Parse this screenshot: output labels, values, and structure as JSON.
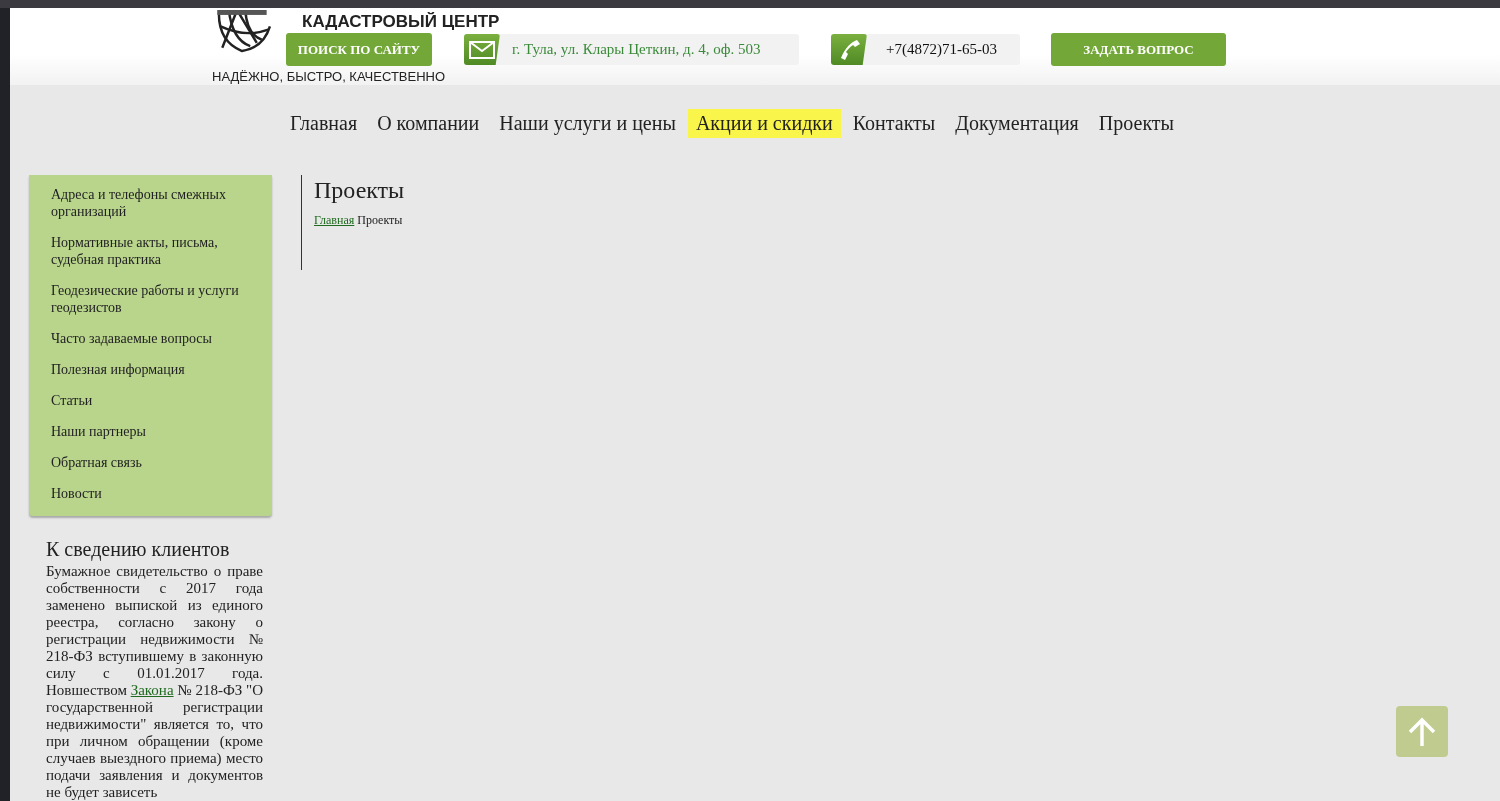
{
  "logo": {
    "title": "КАДАСТРОВЫЙ ЦЕНТР",
    "slogan": "НАДЁЖНО, БЫСТРО, КАЧЕСТВЕННО"
  },
  "header": {
    "search_button": "ПОИСК ПО САЙТУ",
    "address": "г. Тула, ул. Клары Цеткин, д. 4, оф. 503",
    "phone": "+7(4872)71-65-03",
    "ask_button": "ЗАДАТЬ ВОПРОС"
  },
  "nav": [
    {
      "label": "Главная",
      "highlighted": false
    },
    {
      "label": "О компании",
      "highlighted": false
    },
    {
      "label": "Наши услуги и цены",
      "highlighted": false
    },
    {
      "label": "Акции и скидки",
      "highlighted": true
    },
    {
      "label": "Контакты",
      "highlighted": false
    },
    {
      "label": "Документация",
      "highlighted": false
    },
    {
      "label": "Проекты",
      "highlighted": false
    }
  ],
  "sidebar": {
    "items": [
      "Адреса и телефоны смежных организаций",
      "Нормативные акты, письма, судебная практика",
      "Геодезические работы и услуги геодезистов",
      "Часто задаваемые вопросы",
      "Полезная информация",
      "Статьи",
      "Наши партнеры",
      "Обратная связь",
      "Новости"
    ],
    "notice": {
      "title": "К сведению клиентов",
      "text_before": "Бумажное свидетельство о праве собственности с 2017 года заменено выпиской из единого реестра, согласно закону о регистрации недвижимости № 218-ФЗ вступившему в законную силу с 01.01.2017 года. Новшеством ",
      "link": "Закона",
      "text_after": " № 218-ФЗ  \"О государственной регистрации недвижимости\" является то, что при личном обращении (кроме случаев выездного приема) место подачи заявления и документов не будет зависеть"
    }
  },
  "content": {
    "title": "Проекты",
    "breadcrumb": [
      {
        "label": "Главная",
        "kind": "link"
      },
      {
        "label": "Проекты",
        "kind": "current"
      }
    ]
  }
}
